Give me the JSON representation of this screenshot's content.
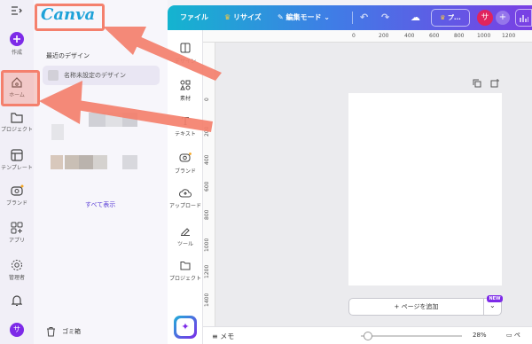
{
  "app": {
    "logo_text": "Canva"
  },
  "rail": {
    "create_label": "作成",
    "home_label": "ホーム",
    "projects_label": "プロジェクト",
    "templates_label": "テンプレート",
    "brand_label": "ブランド",
    "apps_label": "アプリ",
    "admin_label": "管理者"
  },
  "side_panel": {
    "recent_heading": "最近のデザイン",
    "recent_item": "名称未設定のデザイン",
    "show_all": "すべて表示",
    "trash_label": "ゴミ箱"
  },
  "topbar": {
    "file_label": "ファイル",
    "resize_label": "リサイズ",
    "edit_mode_label": "編集モード",
    "share_label": "プ...",
    "avatar_letter": "サ"
  },
  "tools": {
    "design_label": "デザイン",
    "elements_label": "素材",
    "text_label": "テキスト",
    "brand_label": "ブランド",
    "upload_label": "アップロード",
    "tool_label": "ツール",
    "project_label": "プロジェクト"
  },
  "ruler": {
    "top_ticks": [
      "0",
      "200",
      "400",
      "600",
      "800",
      "1000",
      "1200"
    ],
    "left_ticks": [
      "0",
      "200",
      "400",
      "600",
      "800",
      "1000",
      "1200",
      "1400"
    ]
  },
  "canvas": {
    "add_page_label": "+ ページを追加",
    "new_badge": "NEW"
  },
  "bottombar": {
    "notes_label": "メモ",
    "zoom_value": "28%",
    "page_label": "ペ",
    "zoom_fraction": 0.07
  },
  "user": {
    "avatar_letter": "サ"
  },
  "colors": {
    "accent": "#7d2ae8",
    "highlight": "#f4806d",
    "logo": "#1fa2d8",
    "avatar": "#e0245e"
  }
}
